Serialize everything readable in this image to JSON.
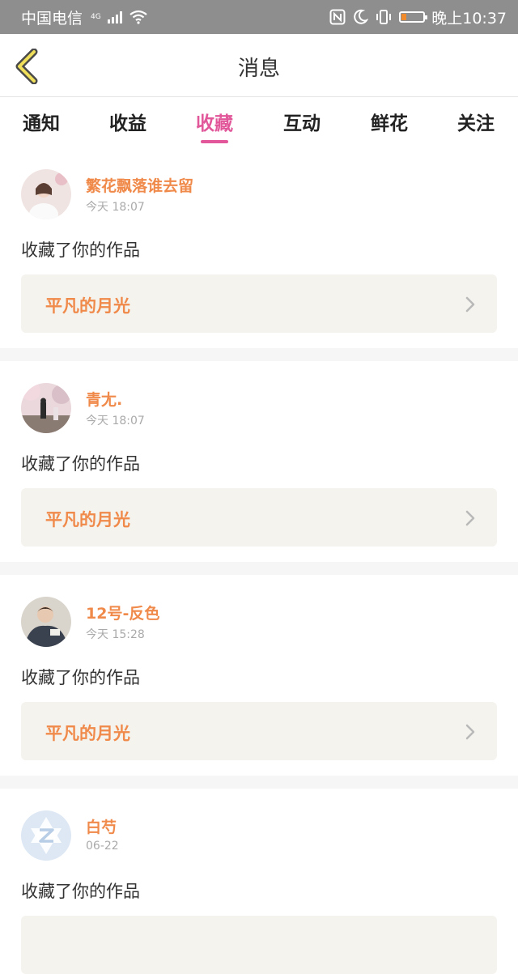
{
  "status_bar": {
    "carrier": "中国电信",
    "network": "4G",
    "time": "晚上10:37",
    "battery_fraction": 0.2
  },
  "header": {
    "title": "消息"
  },
  "tabs": [
    {
      "label": "通知",
      "active": false
    },
    {
      "label": "收益",
      "active": false
    },
    {
      "label": "收藏",
      "active": true
    },
    {
      "label": "互动",
      "active": false
    },
    {
      "label": "鲜花",
      "active": false
    },
    {
      "label": "关注",
      "active": false
    }
  ],
  "messages": [
    {
      "user": "繁花飘落谁去留",
      "time": "今天 18:07",
      "action": "收藏了你的作品",
      "work": "平凡的月光"
    },
    {
      "user": "青尢.",
      "time": "今天 18:07",
      "action": "收藏了你的作品",
      "work": "平凡的月光"
    },
    {
      "user": "12号-反色",
      "time": "今天 15:28",
      "action": "收藏了你的作品",
      "work": "平凡的月光"
    },
    {
      "user": "白芍",
      "time": "06-22",
      "action": "收藏了你的作品",
      "work": ""
    }
  ],
  "colors": {
    "accent_pink": "#e1579a",
    "username_orange": "#f08a4b",
    "status_bar_bg": "#8e8e8e",
    "work_box_bg": "#f4f3ee"
  },
  "icons": {
    "back": "chevron-left-icon",
    "work_arrow": "chevron-right-icon"
  }
}
